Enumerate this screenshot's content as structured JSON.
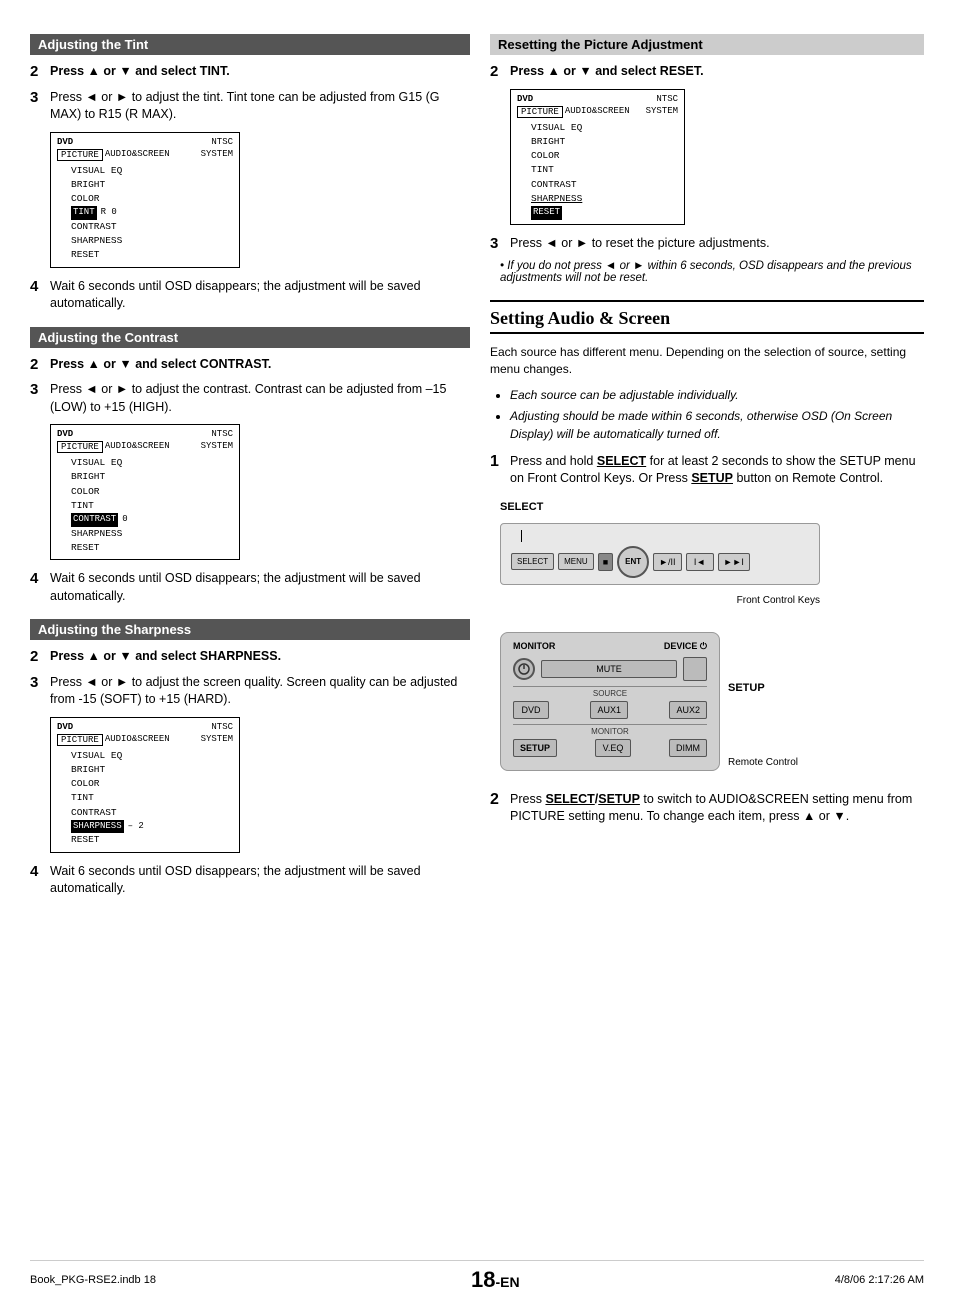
{
  "page": {
    "number": "18",
    "suffix": "-EN",
    "footer_left": "Book_PKG-RSE2.indb   18",
    "footer_right": "4/8/06   2:17:26 AM"
  },
  "tint_section": {
    "header": "Adjusting the Tint",
    "step2": "Press ▲ or ▼ and select TINT.",
    "step2_num": "2",
    "step3_num": "3",
    "step3": "Press ◄ or ► to adjust the tint. Tint tone can be adjusted from G15 (G MAX) to R15 (R MAX).",
    "osd": {
      "dvd": "DVD",
      "ntsc": "NTSC",
      "picture": "PICTURE",
      "audio_screen": "AUDIO&SCREEN",
      "system": "SYSTEM",
      "items": [
        "VISUAL EQ",
        "BRIGHT",
        "COLOR",
        "TINT",
        "CONTRAST",
        "SHARPNESS",
        "RESET"
      ],
      "highlight_item": "TINT",
      "highlight_val": "R  0"
    },
    "step4_num": "4",
    "step4": "Wait 6 seconds until OSD disappears; the adjustment will be saved automatically."
  },
  "contrast_section": {
    "header": "Adjusting the Contrast",
    "step2_num": "2",
    "step2": "Press  ▲ or ▼ and select CONTRAST.",
    "step3_num": "3",
    "step3": "Press ◄ or ► to adjust the contrast. Contrast can be adjusted from –15 (LOW) to +15 (HIGH).",
    "osd": {
      "dvd": "DVD",
      "ntsc": "NTSC",
      "picture": "PICTURE",
      "audio_screen": "AUDIO&SCREEN",
      "system": "SYSTEM",
      "items": [
        "VISUAL EQ",
        "BRIGHT",
        "COLOR",
        "TINT",
        "CONTRAST",
        "SHARPNESS",
        "RESET"
      ],
      "highlight_item": "CONTRAST",
      "highlight_val": "0"
    },
    "step4_num": "4",
    "step4": "Wait 6 seconds until OSD disappears; the adjustment will be saved automatically."
  },
  "sharpness_section": {
    "header": "Adjusting the Sharpness",
    "step2_num": "2",
    "step2": "Press  ▲ or ▼ and select SHARPNESS.",
    "step3_num": "3",
    "step3": "Press ◄ or ► to adjust the screen quality. Screen quality can be adjusted from -15 (SOFT) to +15 (HARD).",
    "osd": {
      "dvd": "DVD",
      "ntsc": "NTSC",
      "picture": "PICTURE",
      "audio_screen": "AUDIO&SCREEN",
      "system": "SYSTEM",
      "items": [
        "VISUAL EQ",
        "BRIGHT",
        "COLOR",
        "TINT",
        "CONTRAST",
        "SHARPNESS",
        "RESET"
      ],
      "highlight_item": "SHARPNESS",
      "highlight_val": "– 2"
    },
    "step4_num": "4",
    "step4": "Wait 6 seconds until OSD disappears; the adjustment will be saved automatically."
  },
  "reset_section": {
    "header": "Resetting the Picture Adjustment",
    "step2_num": "2",
    "step2": "Press ▲ or ▼ and select RESET.",
    "osd": {
      "dvd": "DVD",
      "ntsc": "NTSC",
      "picture": "PICTURE",
      "audio_screen": "AUDIO&SCREEN",
      "system": "SYSTEM",
      "items": [
        "VISUAL EQ",
        "BRIGHT",
        "COLOR",
        "TINT",
        "CONTRAST",
        "SHARPNESS",
        "RESET"
      ],
      "highlight_item": "RESET"
    },
    "step3_num": "3",
    "step3": "Press ◄ or ► to reset the picture adjustments.",
    "note": "If you do not press ◄ or ►  within 6 seconds, OSD disappears and the previous adjustments will not be reset."
  },
  "audio_screen_section": {
    "header": "Setting Audio & Screen",
    "intro": "Each source has different menu. Depending on the selection of source, setting menu changes.",
    "bullets": [
      "Each source can be adjustable individually.",
      "Adjusting should be made within 6 seconds, otherwise OSD (On Screen Display) will be automatically turned off."
    ],
    "step1_num": "1",
    "step1": "Press and hold SELECT for at least 2 seconds to show the SETUP menu on Front Control Keys. Or Press SETUP button on Remote Control.",
    "step1_select_label": "SELECT",
    "front_keys_label": "Front Control Keys",
    "front_keys": [
      "SELECT",
      "MENU",
      "■",
      "ENT",
      "►/II",
      "I◄",
      "►►I"
    ],
    "setup_label": "SETUP",
    "remote_caption": "Remote Control",
    "remote_monitor_label": "MONITOR",
    "remote_device_label": "DEVICE ⏻",
    "remote_source_label": "SOURCE",
    "remote_monitor_label2": "MONITOR",
    "remote_buttons": [
      "MUTE",
      "DVD",
      "AUX1",
      "AUX2",
      "SETUP",
      "V.EQ",
      "DIMM"
    ],
    "step2_num": "2",
    "step2": "Press SELECT/SETUP to switch to AUDIO&SCREEN setting menu from PICTURE setting menu. To change each item, press ▲ or ▼."
  }
}
